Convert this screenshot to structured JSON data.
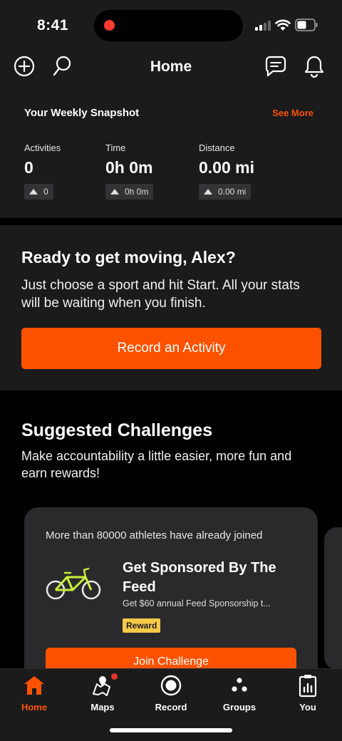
{
  "status_bar": {
    "time": "8:41"
  },
  "header": {
    "title": "Home",
    "icons": [
      "add-icon",
      "search-icon",
      "messages-icon",
      "notifications-icon"
    ]
  },
  "snapshot": {
    "title": "Your Weekly Snapshot",
    "see_more": "See More",
    "stats": [
      {
        "label": "Activities",
        "value": "0",
        "delta": "0"
      },
      {
        "label": "Time",
        "value": "0h 0m",
        "delta": "0h 0m"
      },
      {
        "label": "Distance",
        "value": "0.00 mi",
        "delta": "0.00 mi"
      }
    ]
  },
  "ready": {
    "title": "Ready to get moving, Alex?",
    "text": "Just choose a sport and hit Start. All your stats will be waiting when you finish.",
    "button": "Record an Activity"
  },
  "challenges": {
    "title": "Suggested Challenges",
    "text": "Make accountability a little easier, more fun and earn rewards!",
    "card": {
      "joined": "More than 80000 athletes have already joined",
      "name": "Get Sponsored By The Feed",
      "description": "Get $60 annual Feed Sponsorship t...",
      "badge": "Reward",
      "button": "Join Challenge"
    }
  },
  "tabbar": {
    "items": [
      {
        "label": "Home",
        "icon": "home-icon",
        "active": true
      },
      {
        "label": "Maps",
        "icon": "maps-icon",
        "badge": true
      },
      {
        "label": "Record",
        "icon": "record-icon"
      },
      {
        "label": "Groups",
        "icon": "groups-icon"
      },
      {
        "label": "You",
        "icon": "you-icon"
      }
    ]
  },
  "colors": {
    "accent": "#fc5200",
    "background": "#000000",
    "card": "#1b1b1c",
    "reward": "#f7c948"
  }
}
